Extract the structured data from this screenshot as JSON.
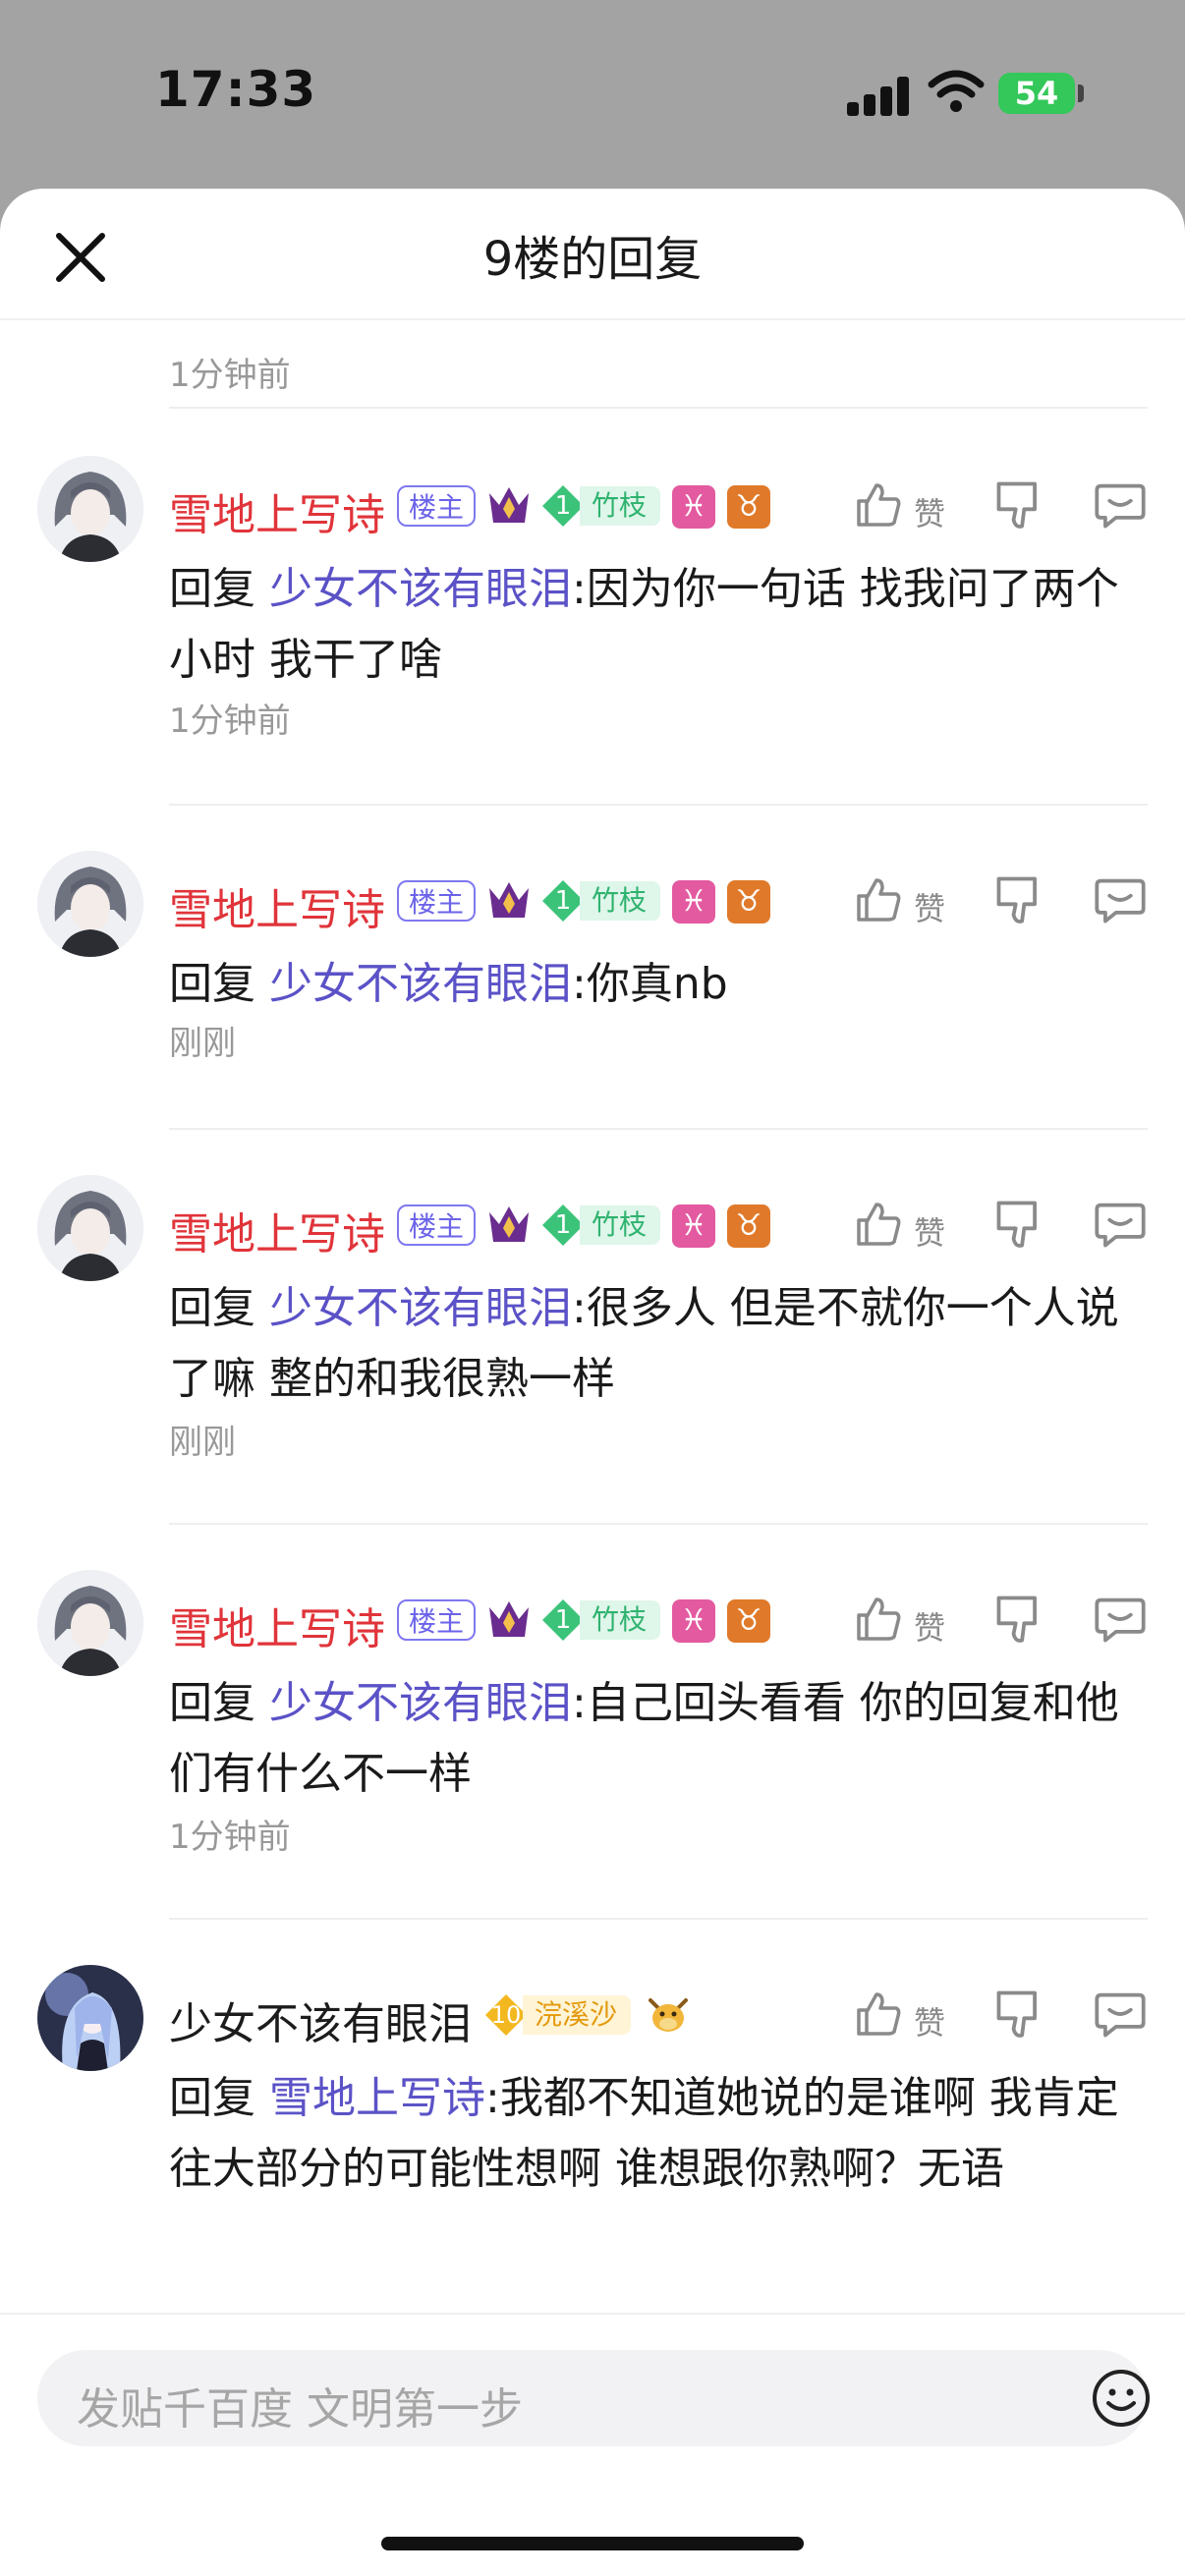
{
  "status_bar": {
    "time": "17:33",
    "battery": "54"
  },
  "header": {
    "title": "9楼的回复"
  },
  "first_time": "1分钟前",
  "comments": [
    {
      "name": "雪地上写诗",
      "owner_badge": "楼主",
      "level": "1",
      "level_title": "竹枝",
      "zodiac1": "♓",
      "zodiac2": "♉",
      "like_label": "赞",
      "reply_word": "回复",
      "target": "少女不该有眼泪",
      "text": ":因为你一句话 找我问了两个小时 我干了啥",
      "time": "1分钟前"
    },
    {
      "name": "雪地上写诗",
      "owner_badge": "楼主",
      "level": "1",
      "level_title": "竹枝",
      "zodiac1": "♓",
      "zodiac2": "♉",
      "like_label": "赞",
      "reply_word": "回复",
      "target": "少女不该有眼泪",
      "text": ":你真nb",
      "time": "刚刚"
    },
    {
      "name": "雪地上写诗",
      "owner_badge": "楼主",
      "level": "1",
      "level_title": "竹枝",
      "zodiac1": "♓",
      "zodiac2": "♉",
      "like_label": "赞",
      "reply_word": "回复",
      "target": "少女不该有眼泪",
      "text": ":很多人 但是不就你一个人说了嘛 整的和我很熟一样",
      "time": "刚刚"
    },
    {
      "name": "雪地上写诗",
      "owner_badge": "楼主",
      "level": "1",
      "level_title": "竹枝",
      "zodiac1": "♓",
      "zodiac2": "♉",
      "like_label": "赞",
      "reply_word": "回复",
      "target": "少女不该有眼泪",
      "text": ":自己回头看看 你的回复和他们有什么不一样",
      "time": "1分钟前"
    },
    {
      "name": "少女不该有眼泪",
      "level": "10",
      "level_title": "浣溪沙",
      "like_label": "赞",
      "reply_word": "回复",
      "target": "雪地上写诗",
      "text": ":我都不知道她说的是谁啊 我肯定往大部分的可能性想啊 谁想跟你熟啊？无语"
    }
  ],
  "input": {
    "placeholder": "发贴千百度 文明第一步"
  },
  "colors": {
    "name_red": "#e0343a",
    "link_purple": "#5b52c7",
    "level_green": "#2fb36f",
    "level_gold": "#e39a0e"
  },
  "icons": [
    "close-icon",
    "thumbs-up-icon",
    "thumbs-down-icon",
    "reply-icon",
    "crown-icon",
    "emoji-icon"
  ]
}
